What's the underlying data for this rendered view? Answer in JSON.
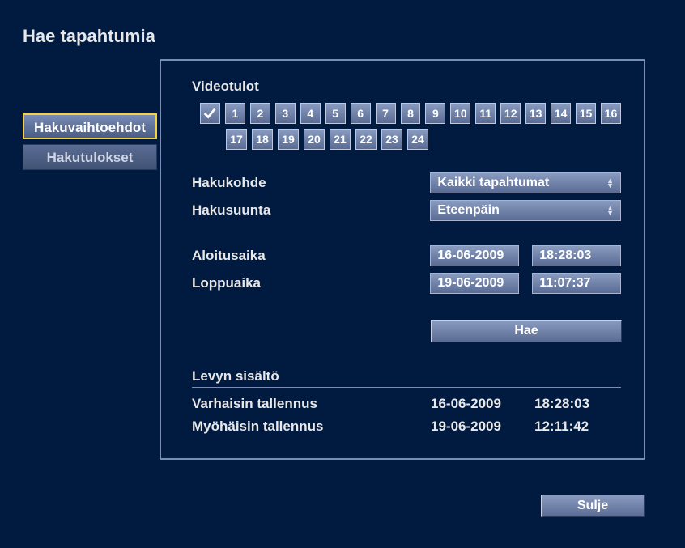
{
  "title": "Hae tapahtumia",
  "sidebar": {
    "tabs": [
      {
        "label": "Hakuvaihtoehdot",
        "active": true
      },
      {
        "label": "Hakutulokset",
        "active": false
      }
    ]
  },
  "panel": {
    "videoInputsLabel": "Videotulot",
    "checkAllChecked": true,
    "inputsRow1": [
      "1",
      "2",
      "3",
      "4",
      "5",
      "6",
      "7",
      "8",
      "9",
      "10",
      "11",
      "12",
      "13",
      "14",
      "15",
      "16"
    ],
    "inputsRow2": [
      "17",
      "18",
      "19",
      "20",
      "21",
      "22",
      "23",
      "24"
    ],
    "searchTargetLabel": "Hakukohde",
    "searchTargetValue": "Kaikki tapahtumat",
    "searchDirectionLabel": "Hakusuunta",
    "searchDirectionValue": "Eteenpäin",
    "startTimeLabel": "Aloitusaika",
    "startDate": "16-06-2009",
    "startTime": "18:28:03",
    "endTimeLabel": "Loppuaika",
    "endDate": "19-06-2009",
    "endTime": "11:07:37",
    "searchButton": "Hae",
    "diskTitle": "Levyn sisältö",
    "earliestLabel": "Varhaisin tallennus",
    "earliestDate": "16-06-2009",
    "earliestTime": "18:28:03",
    "latestLabel": "Myöhäisin tallennus",
    "latestDate": "19-06-2009",
    "latestTime": "12:11:42"
  },
  "closeButton": "Sulje"
}
